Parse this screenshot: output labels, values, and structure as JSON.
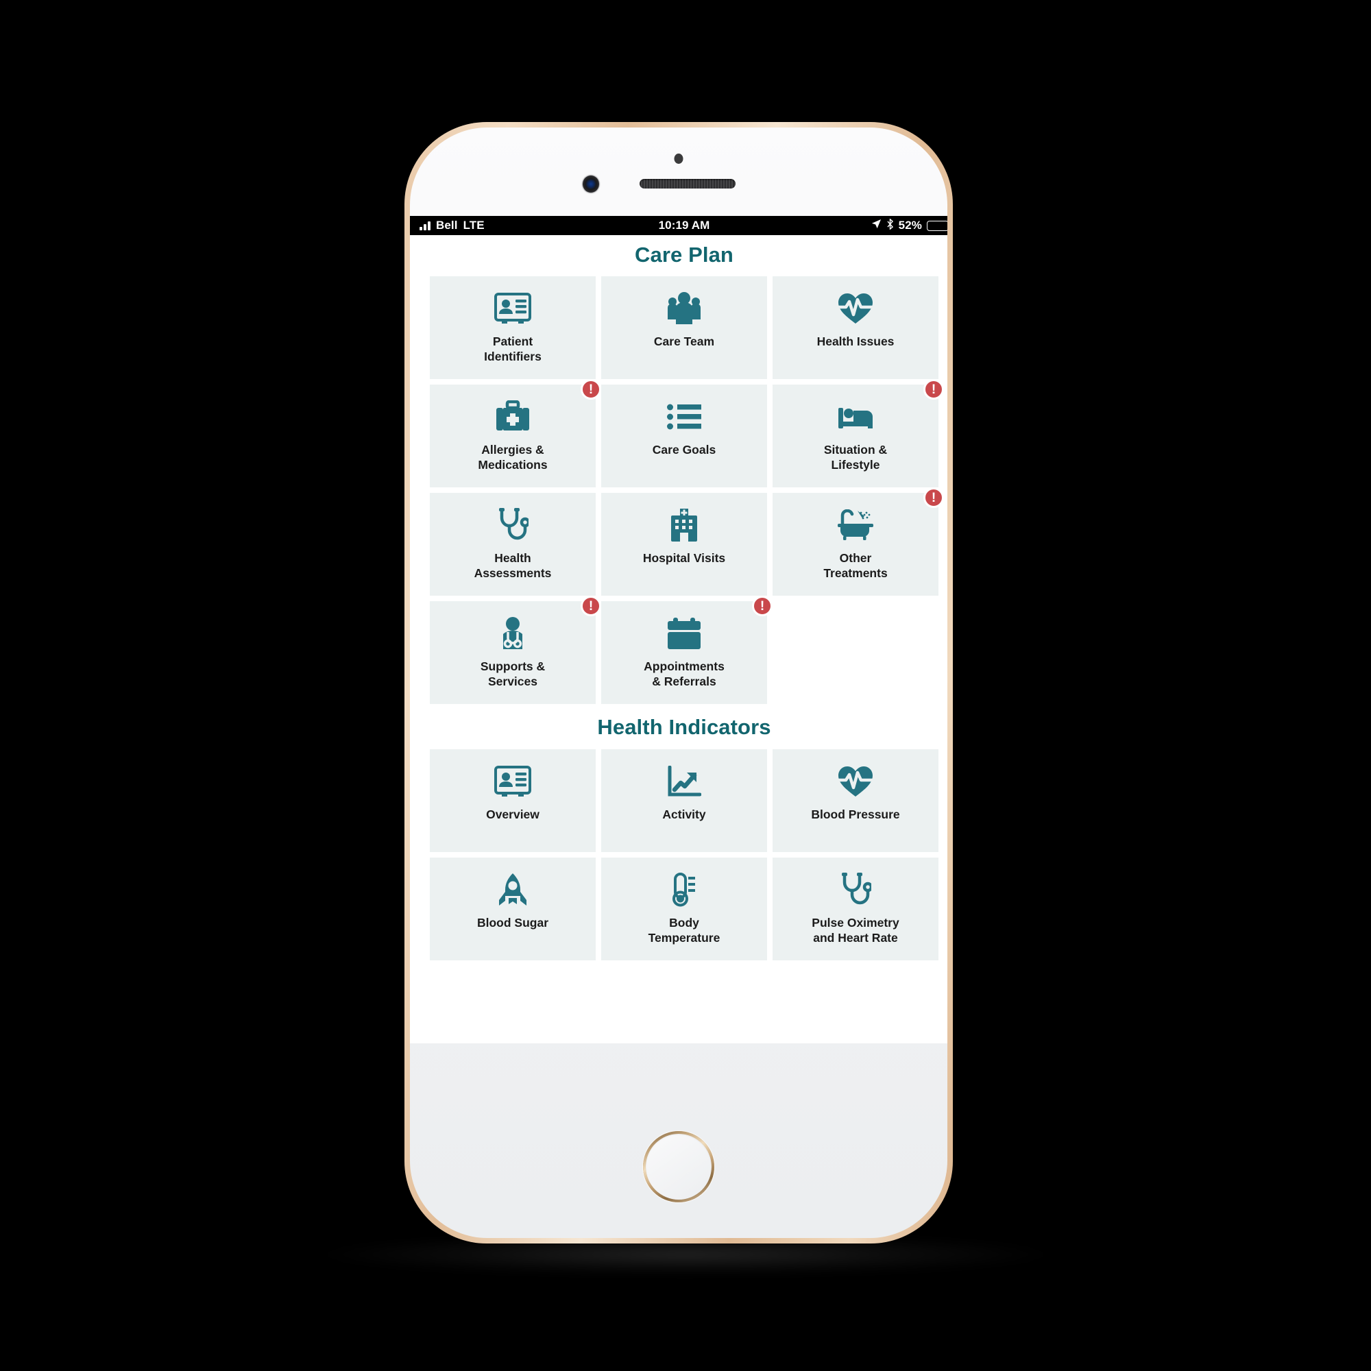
{
  "status_bar": {
    "carrier": "Bell",
    "network": "LTE",
    "time": "10:19 AM",
    "battery_percent": "52%",
    "battery_level": 52,
    "icons": [
      "signal-bars-icon",
      "location-arrow-icon",
      "bluetooth-icon",
      "battery-icon"
    ]
  },
  "colors": {
    "accent_teal": "#257382",
    "title_teal": "#12656E",
    "tile_bg": "#ECF1F1",
    "badge_red": "#C9484B",
    "page_bg": "#FFFFFF",
    "status_bar_bg": "#000000"
  },
  "sections": [
    {
      "id": "care-plan",
      "title": "Care Plan",
      "tiles": [
        {
          "label": "Patient\nIdentifiers",
          "icon": "id-card-icon",
          "badge": null
        },
        {
          "label": "Care Team",
          "icon": "people-group-icon",
          "badge": null
        },
        {
          "label": "Health Issues",
          "icon": "heart-pulse-icon",
          "badge": null
        },
        {
          "label": "Allergies &\nMedications",
          "icon": "medical-kit-icon",
          "badge": "!"
        },
        {
          "label": "Care Goals",
          "icon": "bulleted-list-icon",
          "badge": null
        },
        {
          "label": "Situation &\nLifestyle",
          "icon": "bed-person-icon",
          "badge": "!"
        },
        {
          "label": "Health\nAssessments",
          "icon": "stethoscope-icon",
          "badge": null
        },
        {
          "label": "Hospital Visits",
          "icon": "hospital-building-icon",
          "badge": null
        },
        {
          "label": "Other\nTreatments",
          "icon": "bathtub-shower-icon",
          "badge": "!"
        },
        {
          "label": "Supports &\nServices",
          "icon": "doctor-person-icon",
          "badge": "!"
        },
        {
          "label": "Appointments\n& Referrals",
          "icon": "calendar-icon",
          "badge": "!"
        },
        {
          "label": "",
          "icon": "none",
          "badge": null
        }
      ]
    },
    {
      "id": "health-indicators",
      "title": "Health Indicators",
      "tiles": [
        {
          "label": "Overview",
          "icon": "id-card-icon",
          "badge": null
        },
        {
          "label": "Activity",
          "icon": "chart-trend-up-icon",
          "badge": null
        },
        {
          "label": "Blood Pressure",
          "icon": "heart-pulse-icon",
          "badge": null
        },
        {
          "label": "Blood Sugar",
          "icon": "rocket-icon",
          "badge": null
        },
        {
          "label": "Body\nTemperature",
          "icon": "thermometer-icon",
          "badge": null
        },
        {
          "label": "Pulse Oximetry\nand Heart Rate",
          "icon": "stethoscope-icon",
          "badge": null
        }
      ]
    }
  ]
}
